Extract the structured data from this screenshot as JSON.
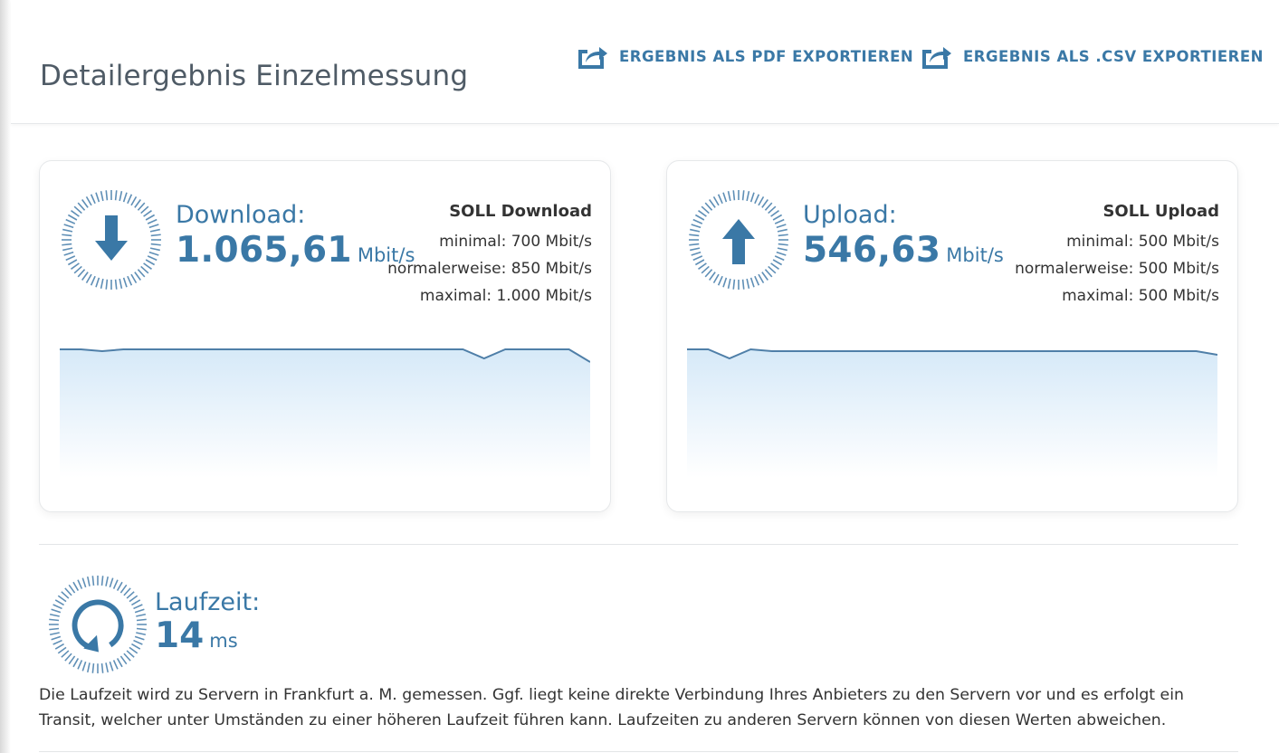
{
  "header": {
    "title": "Detailergebnis Einzelmessung",
    "export_pdf_label": "ERGEBNIS ALS PDF EXPORTIEREN",
    "export_csv_label": "ERGEBNIS ALS .CSV EXPORTIEREN",
    "export_icon": "share-export-icon"
  },
  "colors": {
    "accent": "#3a78a6",
    "chart_fill_top": "#d6e9f8",
    "chart_line": "#4f7fa8"
  },
  "download": {
    "label": "Download:",
    "value": "1.065,61",
    "unit": "Mbit/s",
    "icon": "arrow-down-icon",
    "soll": {
      "title": "SOLL Download",
      "minimal": "minimal: 700 Mbit/s",
      "normal": "normalerweise: 850 Mbit/s",
      "maximal": "maximal: 1.000 Mbit/s"
    }
  },
  "upload": {
    "label": "Upload:",
    "value": "546,63",
    "unit": "Mbit/s",
    "icon": "arrow-up-icon",
    "soll": {
      "title": "SOLL Upload",
      "minimal": "minimal: 500 Mbit/s",
      "normal": "normalerweise: 500 Mbit/s",
      "maximal": "maximal: 500 Mbit/s"
    }
  },
  "latency": {
    "label": "Laufzeit:",
    "value": "14",
    "unit": "ms",
    "icon": "refresh-cycle-icon",
    "note": "Die Laufzeit wird zu Servern in Frankfurt a. M. gemessen. Ggf. liegt keine direkte Verbindung Ihres Anbieters zu den Servern vor und es erfolgt ein Transit, welcher unter Umständen zu einer höheren Laufzeit führen kann. Laufzeiten zu anderen Servern können von diesen Werten abweichen."
  },
  "sparklines": {
    "download": [
      0.985,
      0.985,
      0.98,
      0.985,
      0.985,
      0.985,
      0.985,
      0.985,
      0.985,
      0.985,
      0.985,
      0.985,
      0.985,
      0.985,
      0.985,
      0.985,
      0.985,
      0.985,
      0.985,
      0.985,
      0.96,
      0.985,
      0.985,
      0.985,
      0.985,
      0.95
    ],
    "upload": [
      0.985,
      0.985,
      0.96,
      0.985,
      0.98,
      0.98,
      0.98,
      0.98,
      0.98,
      0.98,
      0.98,
      0.98,
      0.98,
      0.98,
      0.98,
      0.98,
      0.98,
      0.98,
      0.98,
      0.98,
      0.98,
      0.98,
      0.98,
      0.98,
      0.98,
      0.97
    ]
  }
}
